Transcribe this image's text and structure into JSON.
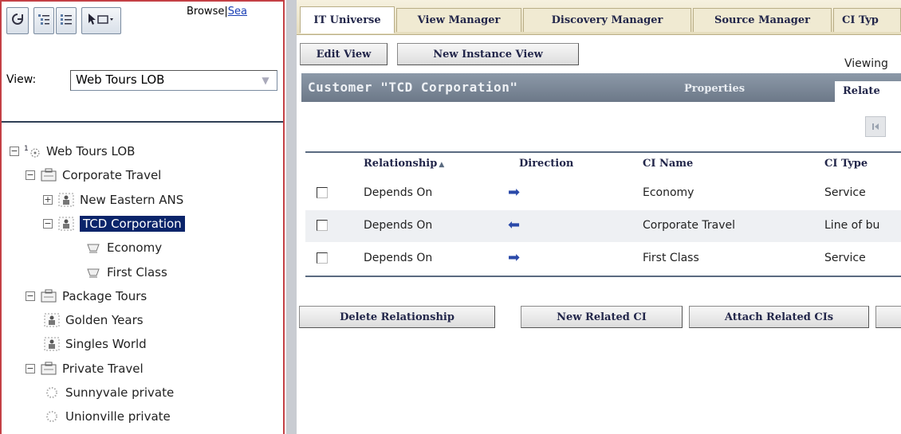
{
  "left": {
    "toolbar": {
      "refresh_icon": "refresh-icon",
      "tree_view_icon": "tree-view-icon",
      "list_view_icon": "list-view-icon",
      "select_menu_icon": "pointer-menu-icon"
    },
    "browse_label": "Browse",
    "search_link": "Sea",
    "view_label": "View:",
    "view_value": "Web Tours LOB",
    "tree": [
      {
        "label": "Web Tours LOB",
        "toggle": "−",
        "level": 0,
        "icon": "view-root-icon",
        "badge": "1"
      },
      {
        "label": "Corporate Travel",
        "toggle": "−",
        "level": 1,
        "icon": "business-folder-icon"
      },
      {
        "label": "New Eastern ANS",
        "toggle": "+",
        "level": 2,
        "icon": "customer-icon"
      },
      {
        "label": "TCD Corporation",
        "toggle": "−",
        "level": 2,
        "icon": "customer-icon",
        "selected": true
      },
      {
        "label": "Economy",
        "toggle": "",
        "level": 3,
        "icon": "service-icon"
      },
      {
        "label": "First Class",
        "toggle": "",
        "level": 3,
        "icon": "service-icon"
      },
      {
        "label": "Package Tours",
        "toggle": "−",
        "level": 1,
        "icon": "business-folder-icon"
      },
      {
        "label": "Golden Years",
        "toggle": "",
        "level": 2,
        "icon": "customer-icon"
      },
      {
        "label": "Singles World",
        "toggle": "",
        "level": 2,
        "icon": "customer-icon"
      },
      {
        "label": "Private Travel",
        "toggle": "−",
        "level": 1,
        "icon": "business-folder-icon"
      },
      {
        "label": "Sunnyvale private",
        "toggle": "",
        "level": 2,
        "icon": "location-icon"
      },
      {
        "label": "Unionville private",
        "toggle": "",
        "level": 2,
        "icon": "location-icon"
      }
    ]
  },
  "tabs": [
    "IT Universe",
    "View Manager",
    "Discovery Manager",
    "Source Manager",
    "CI Typ"
  ],
  "buttons": {
    "edit_view": "Edit View",
    "new_instance_view": "New Instance View",
    "delete_relationship": "Delete Relationship",
    "new_related_ci": "New Related CI",
    "attach_related_cis": "Attach Related CIs"
  },
  "viewing_label": "Viewing",
  "panel": {
    "title": "Customer \"TCD Corporation\"",
    "properties_tab": "Properties",
    "related_tab": "Relate"
  },
  "grid": {
    "columns": [
      "Relationship",
      "Direction",
      "CI Name",
      "CI Type"
    ],
    "sort_indicator": "▲",
    "rows": [
      {
        "relationship": "Depends On",
        "direction": "➡",
        "ci_name": "Economy",
        "ci_type": "Service"
      },
      {
        "relationship": "Depends On",
        "direction": "⬅",
        "ci_name": "Corporate Travel",
        "ci_type": "Line of bu"
      },
      {
        "relationship": "Depends On",
        "direction": "➡",
        "ci_name": "First Class",
        "ci_type": "Service"
      }
    ]
  },
  "colors": {
    "selected_bg": "#0a246a",
    "border_red": "#c44045",
    "panel_header": "#7a8697",
    "arrow_blue": "#2a49a9"
  }
}
